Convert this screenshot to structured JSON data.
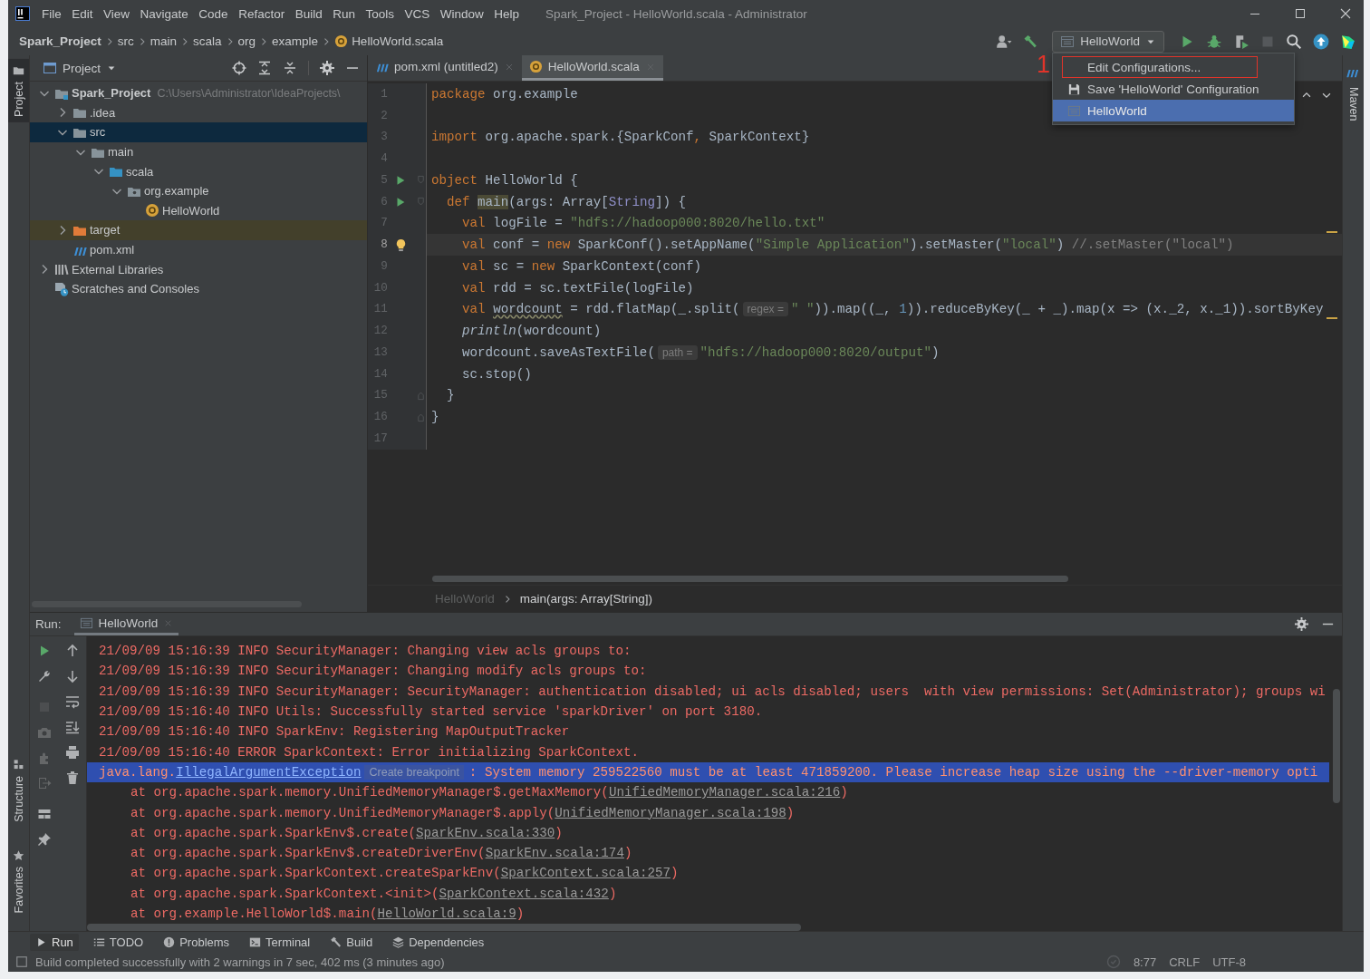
{
  "window": {
    "title": "Spark_Project - HelloWorld.scala - Administrator",
    "menu": [
      "File",
      "Edit",
      "View",
      "Navigate",
      "Code",
      "Refactor",
      "Build",
      "Run",
      "Tools",
      "VCS",
      "Window",
      "Help"
    ]
  },
  "breadcrumbs": [
    {
      "label": "Spark_Project",
      "kind": "project"
    },
    {
      "label": "src",
      "kind": "folder"
    },
    {
      "label": "main",
      "kind": "folder"
    },
    {
      "label": "scala",
      "kind": "folder"
    },
    {
      "label": "org",
      "kind": "folder"
    },
    {
      "label": "example",
      "kind": "folder"
    },
    {
      "label": "HelloWorld.scala",
      "kind": "object"
    }
  ],
  "toolbar": [
    {
      "kind": "user",
      "disabled": false
    },
    {
      "kind": "build",
      "disabled": false
    },
    {
      "kind": "run-config",
      "label": "HelloWorld",
      "disabled": false
    },
    {
      "kind": "run",
      "disabled": false
    },
    {
      "kind": "debug",
      "disabled": false
    },
    {
      "kind": "coverage",
      "disabled": false
    },
    {
      "kind": "stop",
      "disabled": true
    },
    {
      "kind": "search",
      "disabled": false
    },
    {
      "kind": "update",
      "disabled": false
    },
    {
      "kind": "toolbox",
      "disabled": false
    }
  ],
  "run_config_popup": {
    "annotation": "1",
    "items": [
      {
        "label": "Edit Configurations...",
        "kind": "action",
        "selected": false,
        "marked": true
      },
      {
        "label": "Save 'HelloWorld' Configuration",
        "kind": "save",
        "selected": false,
        "marked": false
      },
      {
        "label": "HelloWorld",
        "kind": "config",
        "selected": true,
        "marked": false
      }
    ]
  },
  "left_stripe": [
    {
      "label": "Project",
      "kind": "project",
      "selected": true
    },
    {
      "label": "Structure",
      "kind": "structure",
      "selected": false
    },
    {
      "label": "Favorites",
      "kind": "favorites",
      "selected": false
    }
  ],
  "right_stripe": [
    {
      "label": "Maven",
      "kind": "maven",
      "selected": false
    }
  ],
  "project_panel": {
    "title": "Project",
    "tree": [
      {
        "label": "Spark_Project",
        "path": "C:\\Users\\Administrator\\IdeaProjects\\",
        "kind": "module",
        "expanded": true,
        "selected": false,
        "children": [
          {
            "label": ".idea",
            "kind": "folder",
            "expanded": false,
            "selected": false
          },
          {
            "label": "src",
            "kind": "folder",
            "expanded": true,
            "selected": true,
            "children": [
              {
                "label": "main",
                "kind": "folder",
                "expanded": true,
                "selected": false,
                "children": [
                  {
                    "label": "scala",
                    "kind": "source-folder",
                    "expanded": true,
                    "selected": false,
                    "children": [
                      {
                        "label": "org.example",
                        "kind": "package",
                        "expanded": true,
                        "selected": false,
                        "children": [
                          {
                            "label": "HelloWorld",
                            "kind": "object",
                            "selected": false
                          }
                        ]
                      }
                    ]
                  }
                ]
              }
            ]
          },
          {
            "label": "target",
            "kind": "excluded-folder",
            "expanded": false,
            "selected": false
          },
          {
            "label": "pom.xml",
            "kind": "maven",
            "selected": false
          }
        ]
      },
      {
        "label": "External Libraries",
        "kind": "libraries",
        "expanded": false,
        "selected": false
      },
      {
        "label": "Scratches and Consoles",
        "kind": "scratches",
        "selected": false
      }
    ]
  },
  "editor": {
    "tabs": [
      {
        "label": "pom.xml (untitled2)",
        "kind": "maven",
        "selected": false
      },
      {
        "label": "HelloWorld.scala",
        "kind": "object",
        "selected": true
      }
    ],
    "lines": [
      {
        "number": "1",
        "current": false,
        "tokens": [
          {
            "kind": "keyword",
            "text": "package"
          },
          {
            "kind": "plain",
            "text": " org.example"
          }
        ]
      },
      {
        "number": "2",
        "current": false
      },
      {
        "number": "3",
        "current": false,
        "tokens": [
          {
            "kind": "keyword",
            "text": "import"
          },
          {
            "kind": "plain",
            "text": " org.apache.spark.{SparkConf"
          },
          {
            "kind": "keyword",
            "text": ","
          },
          {
            "kind": "plain",
            "text": " SparkContext}"
          }
        ]
      },
      {
        "number": "4",
        "current": false
      },
      {
        "number": "5",
        "current": false,
        "marker": {
          "kind": "run"
        },
        "fold": {
          "kind": "open"
        },
        "tokens": [
          {
            "kind": "keyword",
            "text": "object"
          },
          {
            "kind": "plain",
            "text": " HelloWorld {"
          }
        ]
      },
      {
        "number": "6",
        "current": false,
        "marker": {
          "kind": "run"
        },
        "fold": {
          "kind": "open"
        },
        "tokens": [
          {
            "kind": "keyword",
            "text": "  def "
          },
          {
            "kind": "usage",
            "text": "main"
          },
          {
            "kind": "plain",
            "text": "(args: Array["
          },
          {
            "kind": "type",
            "text": "String"
          },
          {
            "kind": "plain",
            "text": "]) {"
          }
        ]
      },
      {
        "number": "7",
        "current": false,
        "warning": true,
        "tokens": [
          {
            "kind": "keyword",
            "text": "    val"
          },
          {
            "kind": "plain",
            "text": " logFile = "
          },
          {
            "kind": "string",
            "text": "\"hdfs://hadoop000:8020/hello.txt\""
          }
        ]
      },
      {
        "number": "8",
        "current": true,
        "marker": {
          "kind": "bulb"
        },
        "tokens": [
          {
            "kind": "keyword",
            "text": "    val"
          },
          {
            "kind": "plain",
            "text": " conf = "
          },
          {
            "kind": "keyword",
            "text": "new"
          },
          {
            "kind": "plain",
            "text": " SparkConf().setAppName("
          },
          {
            "kind": "string",
            "text": "\"Simple Application\""
          },
          {
            "kind": "plain",
            "text": ").setMaster("
          },
          {
            "kind": "string",
            "text": "\"local\""
          },
          {
            "kind": "plain",
            "text": ") "
          },
          {
            "kind": "comment",
            "text": "//.setMaster(\"local\")"
          }
        ]
      },
      {
        "number": "9",
        "current": false,
        "tokens": [
          {
            "kind": "keyword",
            "text": "    val"
          },
          {
            "kind": "plain",
            "text": " sc = "
          },
          {
            "kind": "keyword",
            "text": "new"
          },
          {
            "kind": "plain",
            "text": " SparkContext(conf)"
          }
        ]
      },
      {
        "number": "10",
        "current": false,
        "tokens": [
          {
            "kind": "keyword",
            "text": "    val"
          },
          {
            "kind": "plain",
            "text": " rdd = sc.textFile(logFile)"
          }
        ]
      },
      {
        "number": "11",
        "current": false,
        "warning": true,
        "tokens": [
          {
            "kind": "keyword",
            "text": "    val "
          },
          {
            "kind": "unused",
            "text": "wordcount"
          },
          {
            "kind": "plain",
            "text": " = rdd.flatMap(_.split("
          },
          {
            "kind": "hint",
            "text": "regex ="
          },
          {
            "kind": "string",
            "text": "\" \""
          },
          {
            "kind": "plain",
            "text": ")).map((_, "
          },
          {
            "kind": "number",
            "text": "1"
          },
          {
            "kind": "plain",
            "text": ")).reduceByKey(_ + _).map(x => (x._2, x._1)).sortByKey"
          }
        ]
      },
      {
        "number": "12",
        "current": false,
        "tokens": [
          {
            "kind": "italic",
            "text": "    println"
          },
          {
            "kind": "plain",
            "text": "(wordcount)"
          }
        ]
      },
      {
        "number": "13",
        "current": false,
        "tokens": [
          {
            "kind": "plain",
            "text": "    wordcount.saveAsTextFile("
          },
          {
            "kind": "hint",
            "text": "path ="
          },
          {
            "kind": "string",
            "text": "\"hdfs://hadoop000:8020/output\""
          },
          {
            "kind": "plain",
            "text": ")"
          }
        ]
      },
      {
        "number": "14",
        "current": false,
        "tokens": [
          {
            "kind": "plain",
            "text": "    sc.stop()"
          }
        ]
      },
      {
        "number": "15",
        "current": false,
        "fold": {
          "kind": "close"
        },
        "tokens": [
          {
            "kind": "plain",
            "text": "  }"
          }
        ]
      },
      {
        "number": "16",
        "current": false,
        "fold": {
          "kind": "close"
        },
        "tokens": [
          {
            "kind": "plain",
            "text": "}"
          }
        ]
      },
      {
        "number": "17",
        "current": false
      }
    ],
    "breadcrumbs": [
      {
        "label": "HelloWorld",
        "selected": false
      },
      {
        "label": "main(args: Array[String])",
        "selected": true
      }
    ]
  },
  "run_panel": {
    "label": "Run:",
    "tab": {
      "label": "HelloWorld",
      "selected": true
    },
    "tools": [
      {
        "kind": "rerun",
        "disabled": false
      },
      {
        "kind": "wrench",
        "disabled": false
      },
      {
        "kind": "stop",
        "disabled": true
      },
      {
        "kind": "camera",
        "disabled": true
      },
      {
        "kind": "dump",
        "disabled": true
      },
      {
        "kind": "exit",
        "disabled": true
      },
      {
        "kind": "layout",
        "disabled": false
      },
      {
        "kind": "pin",
        "disabled": false
      }
    ],
    "tools_2": [
      {
        "kind": "up",
        "disabled": false
      },
      {
        "kind": "down",
        "disabled": false
      },
      {
        "kind": "wrap",
        "disabled": false
      },
      {
        "kind": "scroll-end",
        "disabled": false
      },
      {
        "kind": "print",
        "disabled": false
      },
      {
        "kind": "trash",
        "disabled": false
      }
    ],
    "lines": [
      {
        "kind": "log",
        "text": "21/09/09 15:16:39 INFO SecurityManager: Changing view acls groups to:",
        "selected": false
      },
      {
        "kind": "log",
        "text": "21/09/09 15:16:39 INFO SecurityManager: Changing modify acls groups to:",
        "selected": false
      },
      {
        "kind": "log",
        "text": "21/09/09 15:16:39 INFO SecurityManager: SecurityManager: authentication disabled; ui acls disabled; users  with view permissions: Set(Administrator); groups wi",
        "selected": false
      },
      {
        "kind": "log",
        "text": "21/09/09 15:16:40 INFO Utils: Successfully started service 'sparkDriver' on port 3180.",
        "selected": false
      },
      {
        "kind": "log",
        "text": "21/09/09 15:16:40 INFO SparkEnv: Registering MapOutputTracker",
        "selected": false
      },
      {
        "kind": "log",
        "text": "21/09/09 15:16:40 ERROR SparkContext: Error initializing SparkContext.",
        "selected": false
      },
      {
        "kind": "exception",
        "text": "java.lang.",
        "link": "IllegalArgumentException",
        "hint": "Create breakpoint",
        "rest": ": System memory 259522560 must be at least 471859200. Please increase heap size using the --driver-memory opti",
        "selected": true
      },
      {
        "kind": "trace",
        "text": "at org.apache.spark.memory.UnifiedMemoryManager$.getMaxMemory(",
        "link": "UnifiedMemoryManager.scala:216",
        "rest": ")",
        "selected": false
      },
      {
        "kind": "trace",
        "text": "at org.apache.spark.memory.UnifiedMemoryManager$.apply(",
        "link": "UnifiedMemoryManager.scala:198",
        "rest": ")",
        "selected": false
      },
      {
        "kind": "trace",
        "text": "at org.apache.spark.SparkEnv$.create(",
        "link": "SparkEnv.scala:330",
        "rest": ")",
        "selected": false
      },
      {
        "kind": "trace",
        "text": "at org.apache.spark.SparkEnv$.createDriverEnv(",
        "link": "SparkEnv.scala:174",
        "rest": ")",
        "selected": false
      },
      {
        "kind": "trace",
        "text": "at org.apache.spark.SparkContext.createSparkEnv(",
        "link": "SparkContext.scala:257",
        "rest": ")",
        "selected": false
      },
      {
        "kind": "trace",
        "text": "at org.apache.spark.SparkContext.<init>(",
        "link": "SparkContext.scala:432",
        "rest": ")",
        "selected": false
      },
      {
        "kind": "trace",
        "text": "at org.example.HelloWorld$.main(",
        "link": "HelloWorld.scala:9",
        "rest": ")",
        "selected": false
      }
    ]
  },
  "tool_windows": [
    {
      "label": "Run",
      "kind": "run",
      "selected": true
    },
    {
      "label": "TODO",
      "kind": "todo",
      "selected": false
    },
    {
      "label": "Problems",
      "kind": "problems",
      "selected": false
    },
    {
      "label": "Terminal",
      "kind": "terminal",
      "selected": false
    },
    {
      "label": "Build",
      "kind": "build",
      "selected": false
    },
    {
      "label": "Dependencies",
      "kind": "dependencies",
      "selected": false
    }
  ],
  "status_bar": {
    "message": "Build completed successfully with 2 warnings in 7 sec, 402 ms (3 minutes ago)",
    "position": "8:77",
    "line_separator": "CRLF",
    "encoding": "UTF-8"
  }
}
